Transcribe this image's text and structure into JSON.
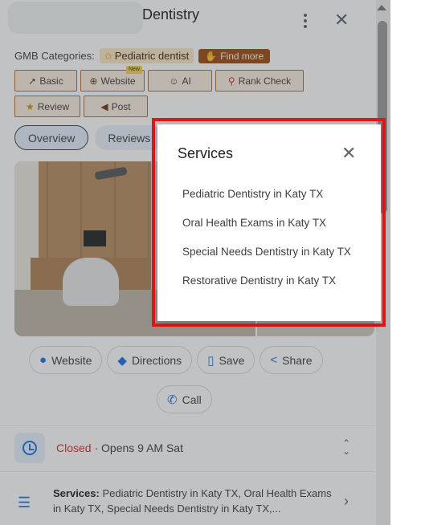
{
  "header": {
    "title": "Dentistry"
  },
  "gmb": {
    "label": "GMB Categories:",
    "category": "Pediatric dentist",
    "find_more": "Find more"
  },
  "tools": [
    {
      "label": "Basic",
      "icon": "rocket-icon"
    },
    {
      "label": "Website",
      "icon": "globe-icon",
      "badge": "New"
    },
    {
      "label": "AI",
      "icon": "robot-icon"
    },
    {
      "label": "Rank Check",
      "icon": "map-pin-icon"
    },
    {
      "label": "Review",
      "icon": "star-icon"
    },
    {
      "label": "Post",
      "icon": "megaphone-icon"
    }
  ],
  "tabs": [
    {
      "label": "Overview",
      "active": true
    },
    {
      "label": "Reviews",
      "active": false
    }
  ],
  "actions": {
    "website": "Website",
    "directions": "Directions",
    "save": "Save",
    "share": "Share",
    "call": "Call"
  },
  "hours": {
    "status": "Closed",
    "detail": " · Opens 9 AM Sat"
  },
  "services_row": {
    "label": "Services:",
    "text": " Pediatric Dentistry in Katy TX, Oral Health Exams in Katy TX, Special Needs Dentistry in Katy TX,..."
  },
  "popup": {
    "title": "Services",
    "items": [
      "Pediatric Dentistry in Katy TX",
      "Oral Health Exams in Katy TX",
      "Special Needs Dentistry in Katy TX",
      "Restorative Dentistry in Katy TX"
    ]
  },
  "colors": {
    "accent": "#1a73e8",
    "highlight_border": "#e3151a",
    "closed": "#d93025",
    "tool_border": "#b26a34"
  }
}
